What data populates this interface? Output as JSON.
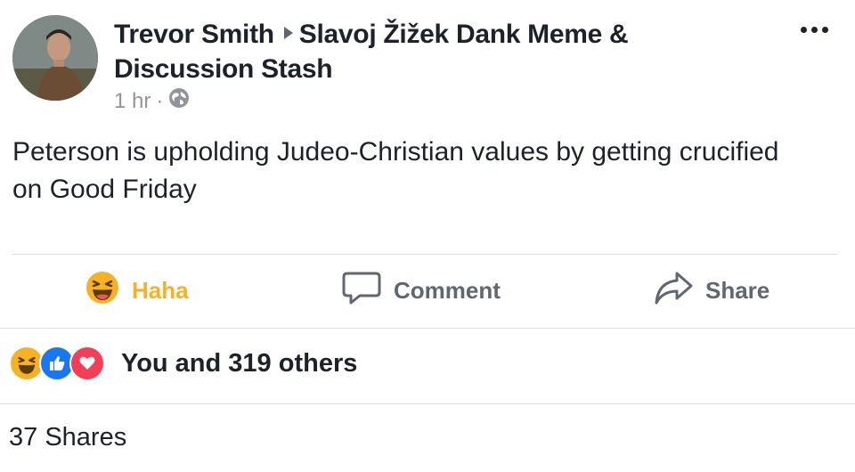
{
  "post": {
    "author": "Trevor Smith",
    "group": "Slavoj Žižek Dank Meme & Discussion Stash",
    "time": "1 hr",
    "separator": "·",
    "privacy_icon": "globe-icon",
    "text": "Peterson is upholding Judeo-Christian values by getting crucified on Good Friday"
  },
  "actions": {
    "reaction_label": "Haha",
    "comment_label": "Comment",
    "share_label": "Share"
  },
  "reactions": {
    "icons": [
      "haha-icon",
      "like-icon",
      "love-icon"
    ],
    "summary": "You and 319 others"
  },
  "shares": {
    "text": "37 Shares"
  },
  "colors": {
    "haha": "#f7b125",
    "like": "#1877f2",
    "love": "#f33e58",
    "text": "#1d2129",
    "muted": "#606770"
  }
}
